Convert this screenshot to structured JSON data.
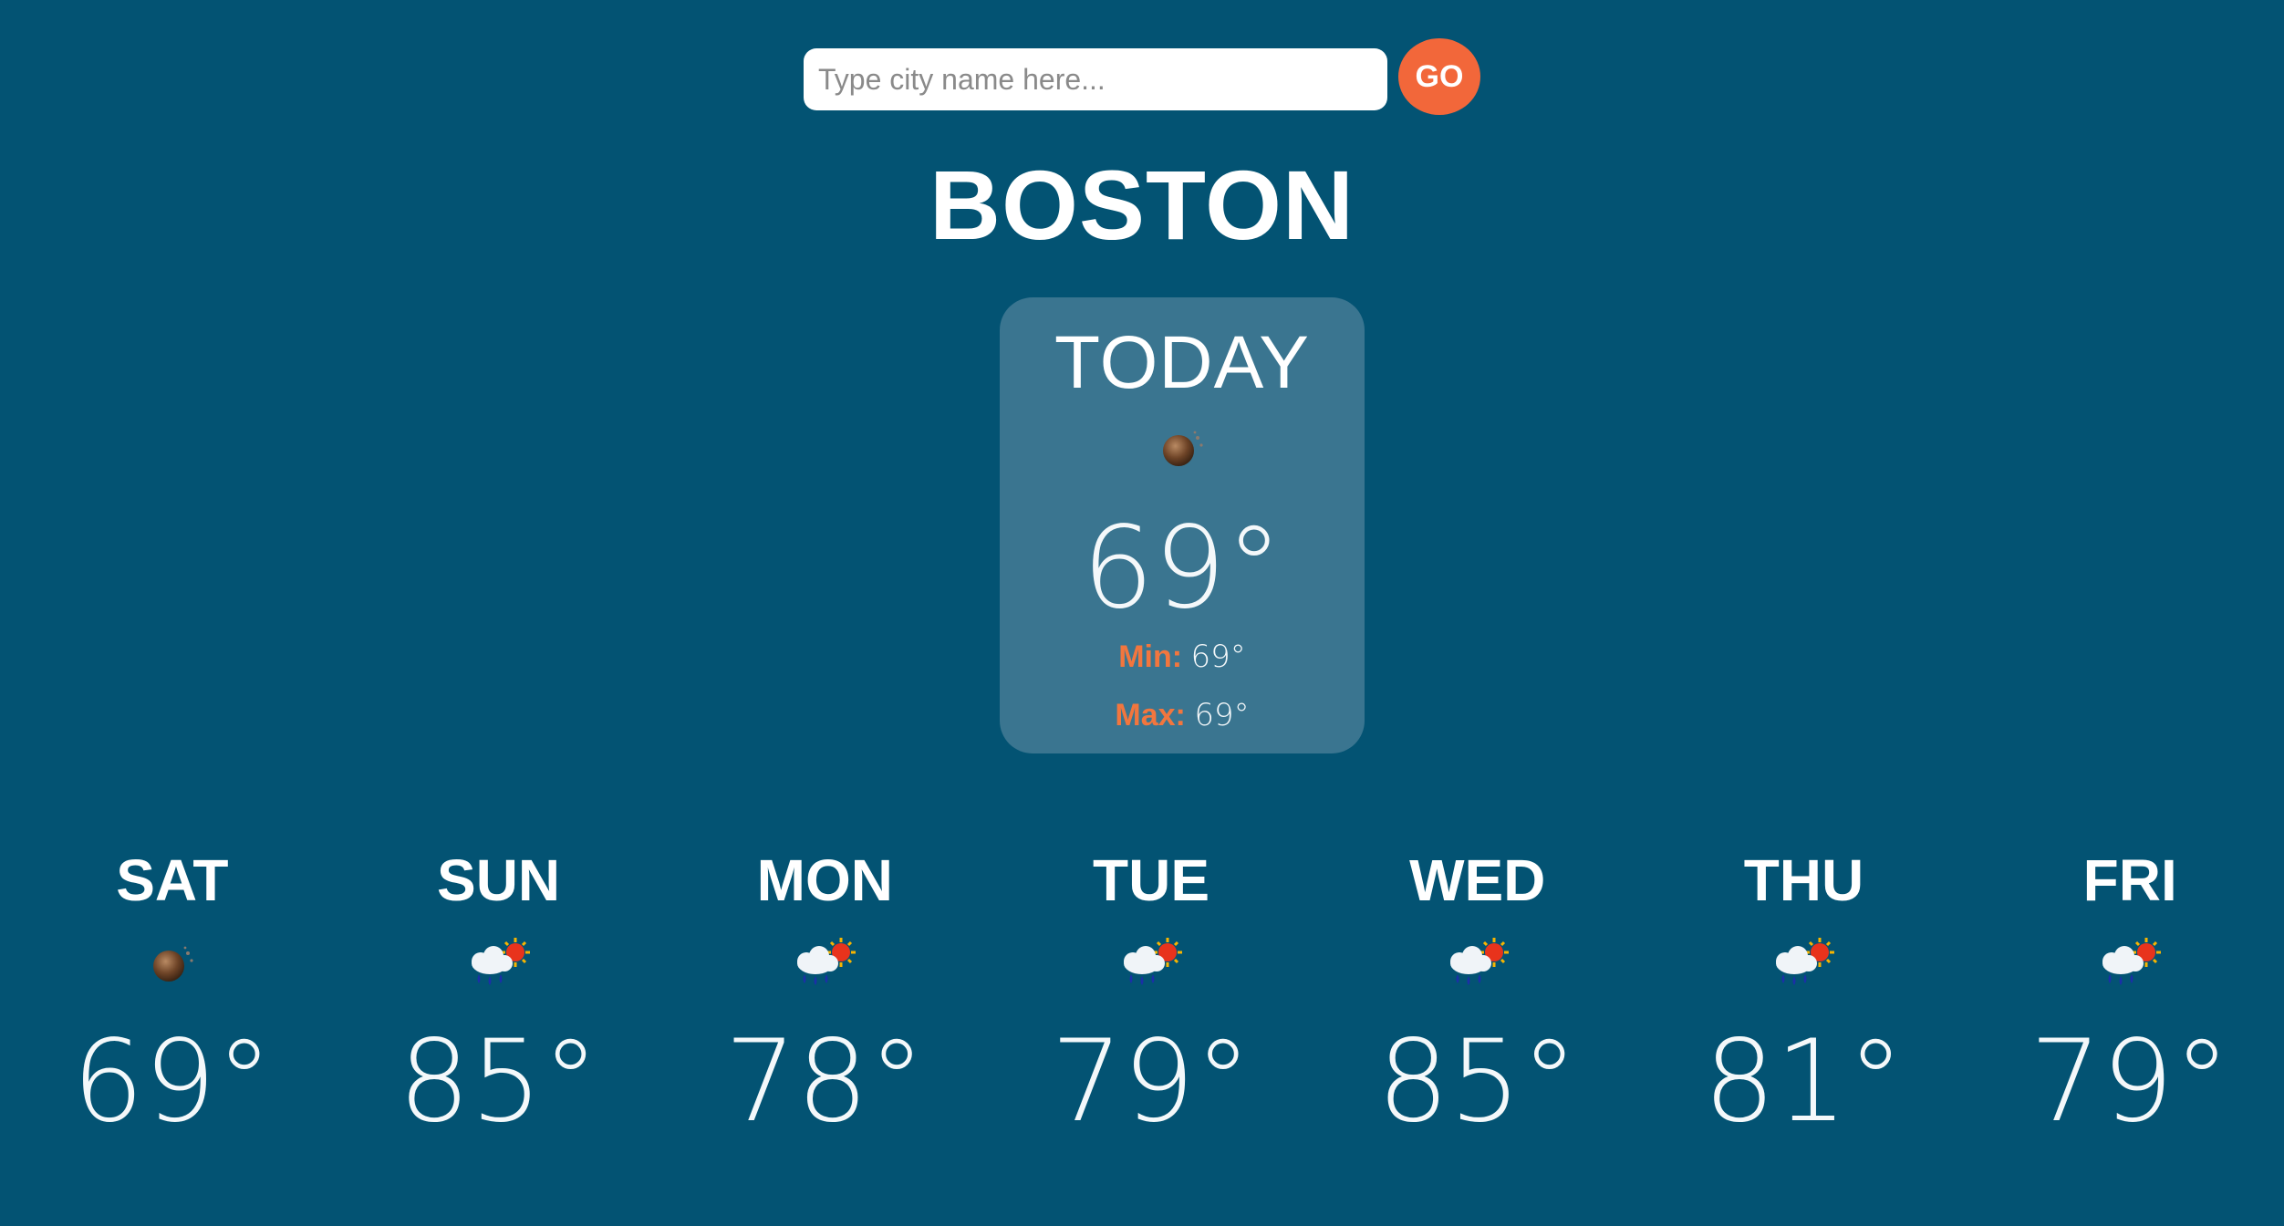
{
  "search": {
    "placeholder": "Type city name here...",
    "value": "",
    "go_label": "GO"
  },
  "city": "BOSTON",
  "today": {
    "label": "TODAY",
    "icon": "moon-icon",
    "temp": "69°",
    "min_label": "Min:",
    "min_value": "69°",
    "max_label": "Max:",
    "max_value": "69°"
  },
  "forecast": [
    {
      "day": "SAT",
      "icon": "moon-icon",
      "temp": "69°"
    },
    {
      "day": "SUN",
      "icon": "rain-sun-cloud-icon",
      "temp": "85°"
    },
    {
      "day": "MON",
      "icon": "rain-sun-cloud-icon",
      "temp": "78°"
    },
    {
      "day": "TUE",
      "icon": "rain-sun-cloud-icon",
      "temp": "79°"
    },
    {
      "day": "WED",
      "icon": "rain-sun-cloud-icon",
      "temp": "85°"
    },
    {
      "day": "THU",
      "icon": "rain-sun-cloud-icon",
      "temp": "81°"
    },
    {
      "day": "FRI",
      "icon": "rain-sun-cloud-icon",
      "temp": "79°"
    }
  ],
  "colors": {
    "background": "#035373",
    "card": "#3a7590",
    "accent": "#f2673a",
    "label_accent": "#f2763e"
  }
}
